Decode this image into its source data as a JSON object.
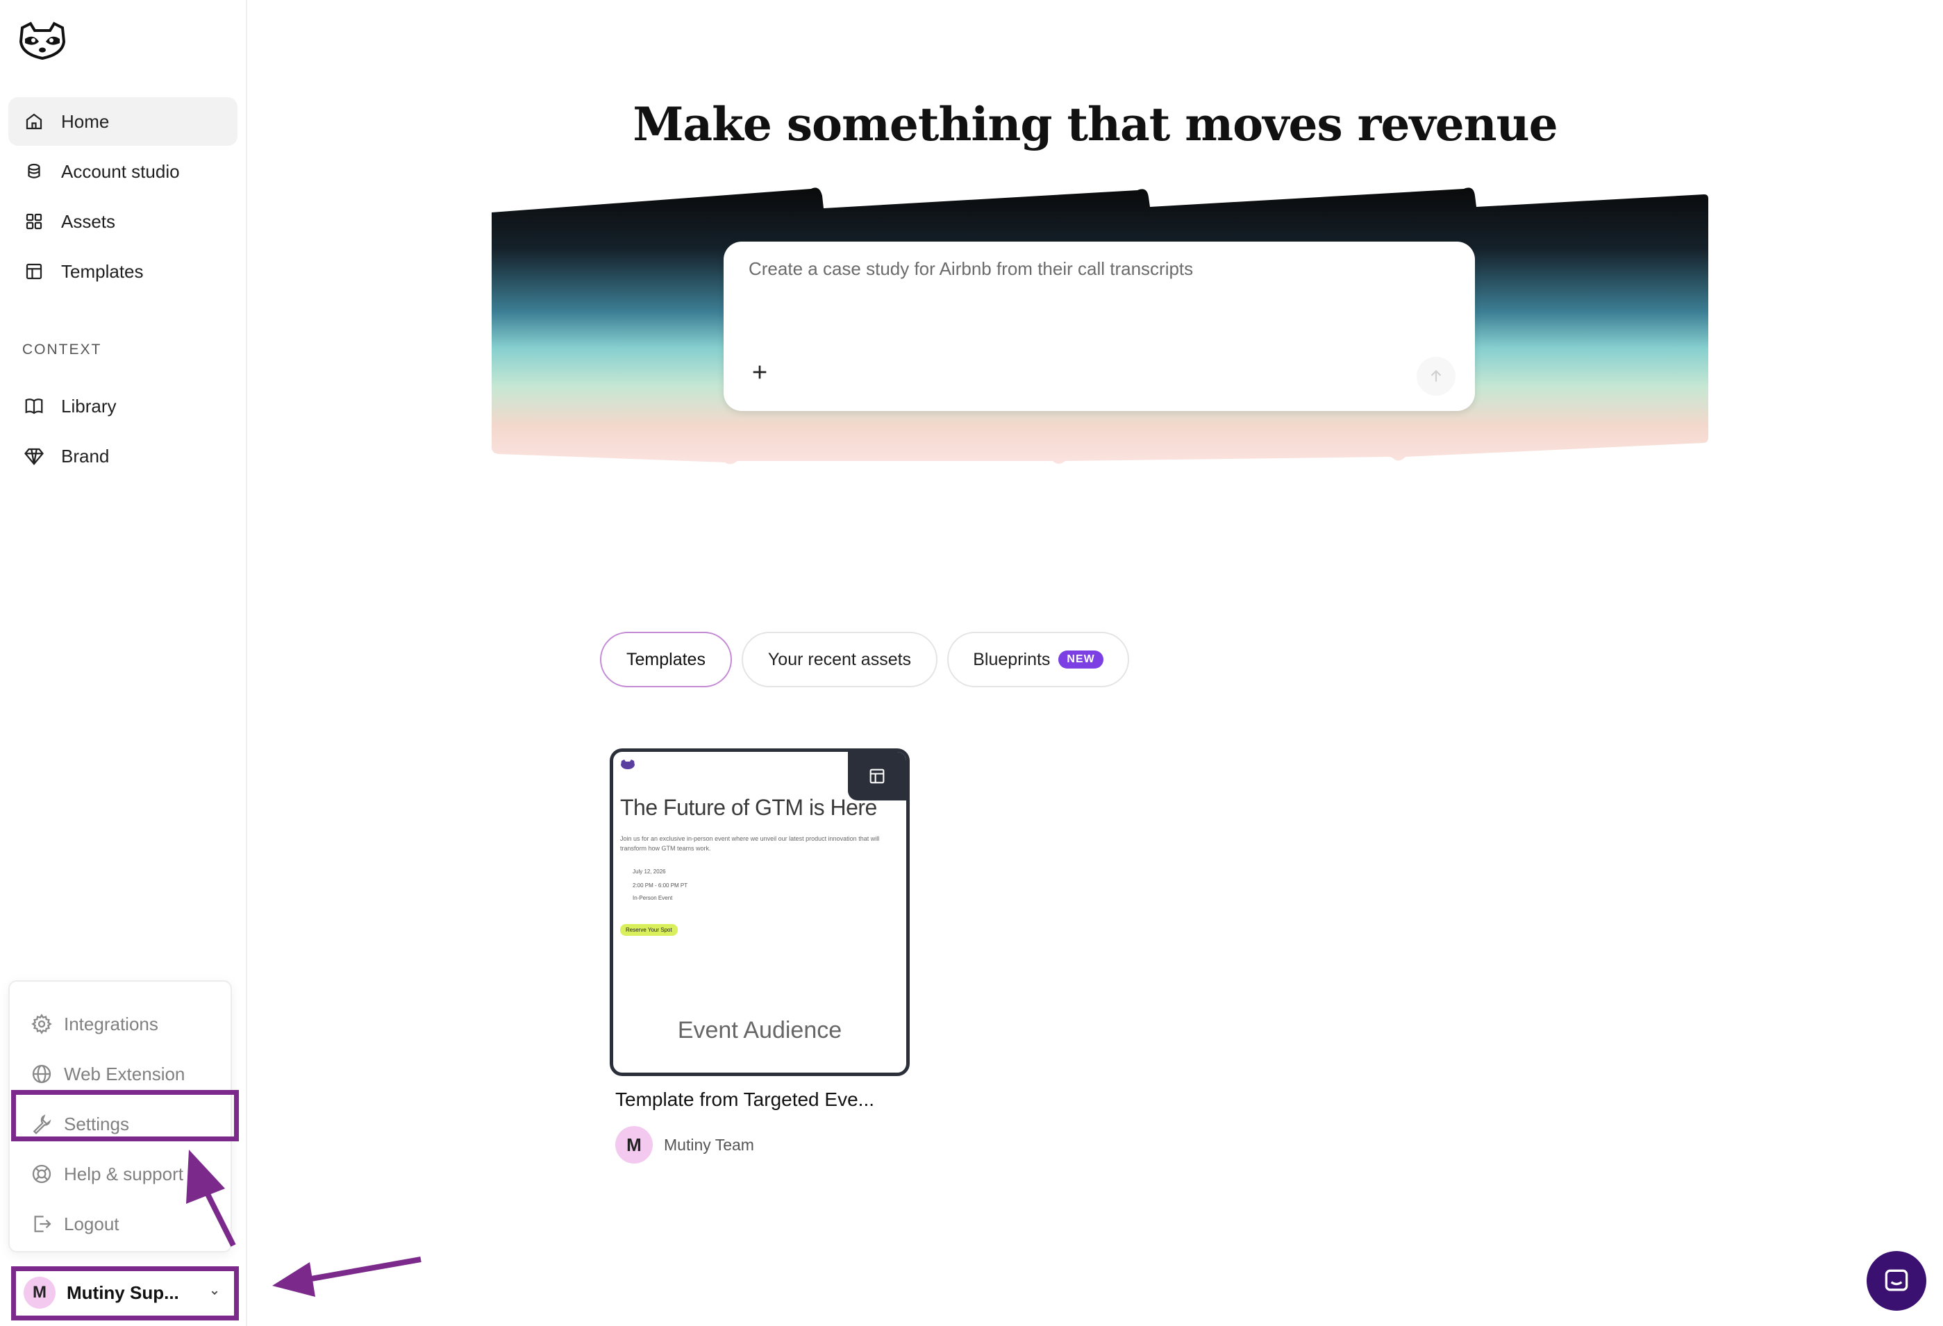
{
  "sidebar": {
    "nav": [
      {
        "label": "Home",
        "icon": "home-icon",
        "active": true
      },
      {
        "label": "Account studio",
        "icon": "database-icon"
      },
      {
        "label": "Assets",
        "icon": "grid-icon"
      },
      {
        "label": "Templates",
        "icon": "layout-icon"
      }
    ],
    "context_label": "CONTEXT",
    "context": [
      {
        "label": "Library",
        "icon": "book-icon"
      },
      {
        "label": "Brand",
        "icon": "gem-icon"
      }
    ],
    "menu": [
      {
        "label": "Integrations",
        "icon": "gear-icon"
      },
      {
        "label": "Web Extension",
        "icon": "globe-icon"
      },
      {
        "label": "Settings",
        "icon": "wrench-icon"
      },
      {
        "label": "Help & support",
        "icon": "lifebuoy-icon"
      },
      {
        "label": "Logout",
        "icon": "logout-icon"
      }
    ],
    "user": {
      "initial": "M",
      "name": "Mutiny Sup..."
    }
  },
  "main": {
    "headline": "Make something that moves revenue",
    "prompt_placeholder": "Create a case study for Airbnb from their call transcripts",
    "tabs": [
      {
        "label": "Templates",
        "active": true
      },
      {
        "label": "Your recent assets"
      },
      {
        "label": "Blueprints",
        "badge": "NEW"
      }
    ],
    "cards": [
      {
        "title": "The Future of GTM is Here",
        "subtitle": "Join us for an exclusive in-person event where we unveil our latest product innovation that will transform how GTM teams work.",
        "date": "July 12, 2026",
        "time": "2:00 PM - 6:00 PM PT",
        "type": "In-Person Event",
        "button": "Reserve Your Spot",
        "footer": "Event Audience",
        "caption": "Template from Targeted Eve...",
        "author_initial": "M",
        "author": "Mutiny Team"
      }
    ]
  },
  "colors": {
    "accent": "#7b3fe4",
    "annotation": "#7b2a8c",
    "avatar": "#f3c9f0",
    "chat": "#3a1170"
  }
}
